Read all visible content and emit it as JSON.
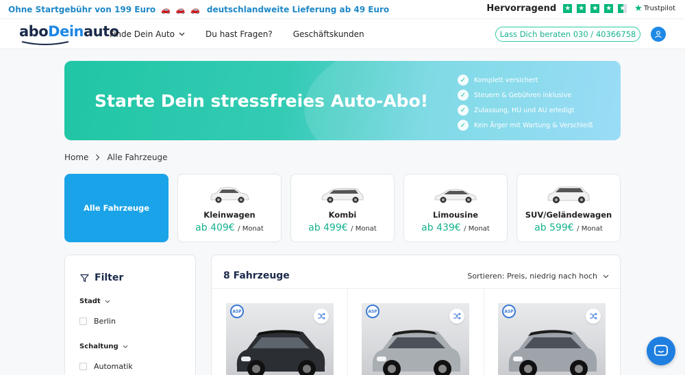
{
  "promo": {
    "left_text": "Ohne Startgebühr von 199 Euro",
    "cars": "🚗 🚗 🚗",
    "right_text": "deutschlandweite Lieferung ab 49 Euro",
    "rating_label": "Hervorragend",
    "trustpilot": "Trustpilot",
    "stars": 4.5
  },
  "nav": {
    "logo_prefix": "abo",
    "logo_accent": "Dein",
    "logo_suffix": "auto",
    "menu": [
      {
        "label": "Finde Dein Auto"
      },
      {
        "label": "Du hast Fragen?"
      },
      {
        "label": "Geschäftskunden"
      }
    ],
    "cta_label": "Lass Dich beraten 030 / 40366758"
  },
  "hero": {
    "title": "Starte Dein stressfreies Auto-Abo!",
    "benefits": [
      "Komplett versichert",
      "Steuern & Gebühren inklusive",
      "Zulassung, HU und AU erledigt",
      "Kein Ärger mit Wartung & Verschleiß"
    ]
  },
  "breadcrumb": {
    "home": "Home",
    "current": "Alle Fahrzeuge"
  },
  "categories": {
    "all_label": "Alle Fahrzeuge",
    "items": [
      {
        "name": "Kleinwagen",
        "price": "ab 409€",
        "unit": "/ Monat"
      },
      {
        "name": "Kombi",
        "price": "ab 499€",
        "unit": "/ Monat"
      },
      {
        "name": "Limousine",
        "price": "ab 439€",
        "unit": "/ Monat"
      },
      {
        "name": "SUV/Geländewagen",
        "price": "ab 599€",
        "unit": "/ Monat"
      }
    ]
  },
  "filter": {
    "title": "Filter",
    "groups": [
      {
        "label": "Stadt",
        "option": "Berlin"
      },
      {
        "label": "Schaltung",
        "option": "Automatik"
      }
    ]
  },
  "results": {
    "count_label": "8 Fahrzeuge",
    "sort_label": "Sortieren: Preis, niedrig nach hoch",
    "badge": "ASP",
    "cars": [
      {
        "color": "#2b2e33",
        "roof": "#111"
      },
      {
        "color": "#a9aeb3",
        "roof": "#1c1c1c"
      },
      {
        "color": "#9ea4aa",
        "roof": "#1c1c1c"
      }
    ]
  },
  "colors": {
    "brand": "#1e88e5",
    "accent_green": "#16b28f",
    "trustpilot_green": "#00b67a"
  }
}
